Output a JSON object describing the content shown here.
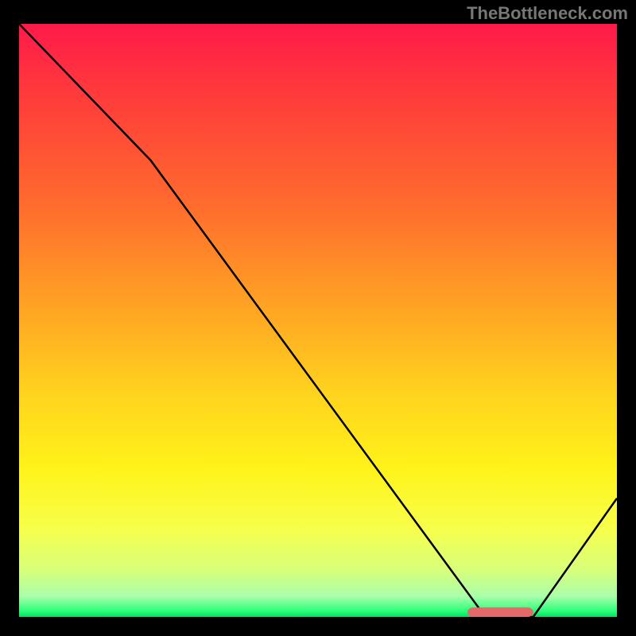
{
  "watermark": "TheBottleneck.com",
  "chart_data": {
    "type": "line",
    "title": "",
    "xlabel": "",
    "ylabel": "",
    "xlim": [
      0,
      100
    ],
    "ylim": [
      0,
      100
    ],
    "series": [
      {
        "name": "bottleneck-curve",
        "x": [
          0,
          22,
          78,
          86,
          100
        ],
        "y": [
          100,
          77,
          0,
          0,
          20
        ]
      }
    ],
    "marker": {
      "x_start": 75,
      "x_end": 86,
      "y": 0
    },
    "gradient_stops": [
      {
        "offset": 0.0,
        "color": "#ff1a4a"
      },
      {
        "offset": 0.12,
        "color": "#ff3b3b"
      },
      {
        "offset": 0.3,
        "color": "#ff6a2e"
      },
      {
        "offset": 0.48,
        "color": "#ffa423"
      },
      {
        "offset": 0.62,
        "color": "#ffd21e"
      },
      {
        "offset": 0.75,
        "color": "#fff31a"
      },
      {
        "offset": 0.85,
        "color": "#f7ff4a"
      },
      {
        "offset": 0.92,
        "color": "#d8ff7a"
      },
      {
        "offset": 0.965,
        "color": "#aaffaa"
      },
      {
        "offset": 0.99,
        "color": "#2bff7a"
      },
      {
        "offset": 1.0,
        "color": "#00e060"
      }
    ]
  }
}
